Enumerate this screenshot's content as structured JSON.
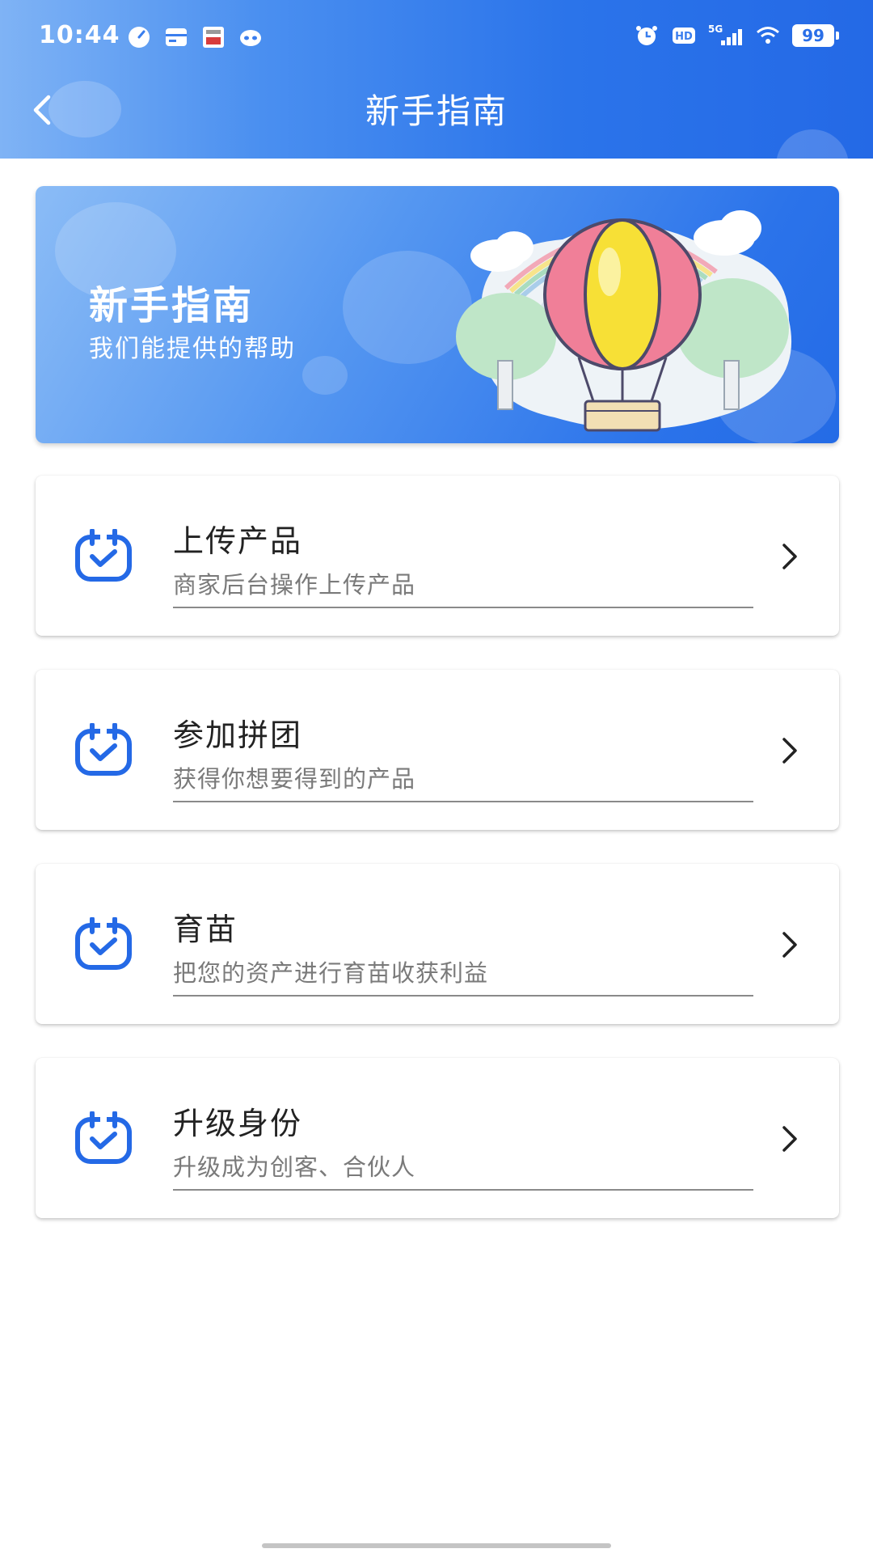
{
  "status_bar": {
    "time": "10:44",
    "battery": "99",
    "network": "5G"
  },
  "nav": {
    "title": "新手指南"
  },
  "banner": {
    "title": "新手指南",
    "subtitle": "我们能提供的帮助"
  },
  "colors": {
    "accent": "#2469E6",
    "title_text": "#222222",
    "desc_text": "#7A7A7A"
  },
  "guides": [
    {
      "title": "上传产品",
      "description": "商家后台操作上传产品",
      "icon": "calendar-check-icon"
    },
    {
      "title": "参加拼团",
      "description": "获得你想要得到的产品",
      "icon": "calendar-check-icon"
    },
    {
      "title": "育苗",
      "description": "把您的资产进行育苗收获利益",
      "icon": "calendar-check-icon"
    },
    {
      "title": "升级身份",
      "description": "升级成为创客、合伙人",
      "icon": "calendar-check-icon"
    }
  ]
}
